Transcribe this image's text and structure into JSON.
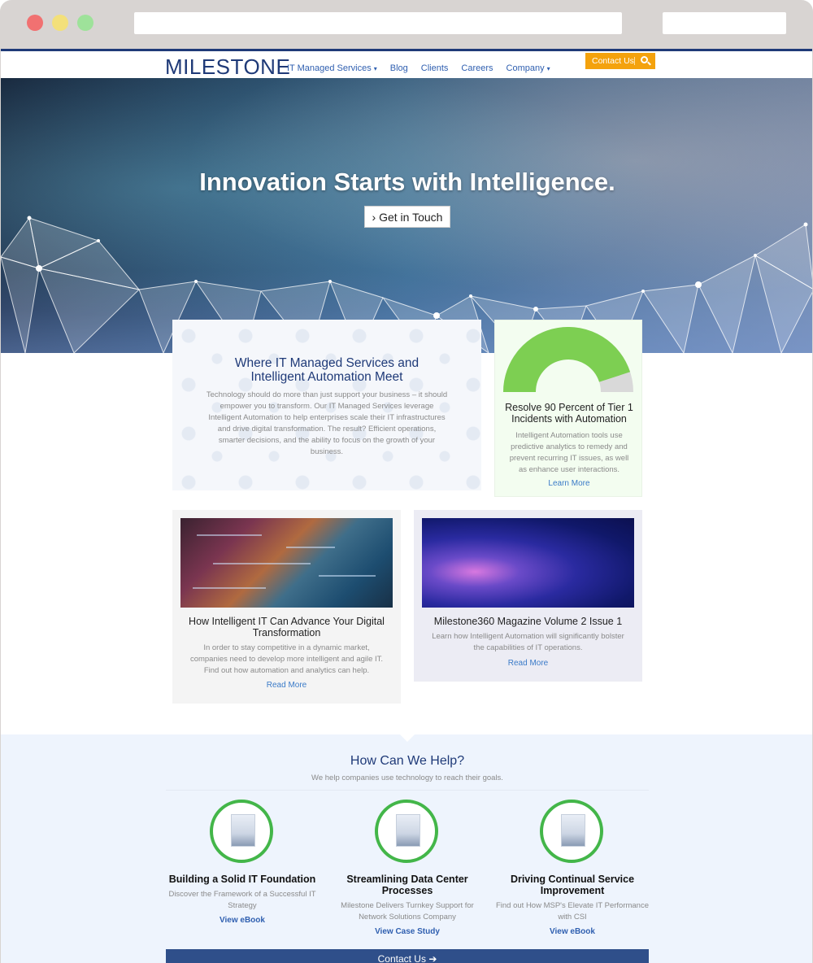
{
  "nav": {
    "logo_text": "MILESTONE",
    "links": [
      "IT Managed Services",
      "Blog",
      "Clients",
      "Careers",
      "Company"
    ],
    "contact_label": "Contact Us",
    "accent": "#f4a20d",
    "brand": "#1f3a78"
  },
  "hero": {
    "title": "Innovation Starts with Intelligence.",
    "button_label": "Get in Touch"
  },
  "intro": {
    "heading": "Where IT Managed Services and Intelligent Automation Meet",
    "body": "Technology should do more than just support your business – it should empower you to transform. Our IT Managed Services leverage Intelligent Automation to help enterprises scale their IT infrastructures and drive digital transformation. The result? Efficient operations, smarter decisions, and the ability to focus on the growth of your business."
  },
  "gauge_card": {
    "percent": 90,
    "title": "Resolve 90 Percent of Tier 1 Incidents with Automation",
    "body": "Intelligent Automation tools use predictive analytics to remedy and prevent recurring IT issues, as well as enhance user interactions.",
    "link": "Learn More",
    "fill_color": "#7dcf52",
    "rest_color": "#d9d9d9"
  },
  "articles": [
    {
      "title": "How Intelligent IT Can Advance Your Digital Transformation",
      "body": "In order to stay competitive in a dynamic market, companies need to develop more intelligent and agile IT. Find out how automation and analytics can help.",
      "link": "Read More"
    },
    {
      "title": "Milestone360 Magazine Volume 2 Issue 1",
      "body": "Learn how Intelligent Automation will significantly bolster the capabilities of IT operations.",
      "link": "Read More"
    }
  ],
  "help": {
    "heading": "How Can We Help?",
    "subheading": "We help companies use technology to reach their goals.",
    "items": [
      {
        "title": "Building a Solid IT Foundation",
        "body": "Discover the Framework of a Successful IT Strategy",
        "link": "View eBook"
      },
      {
        "title": "Streamlining Data Center Processes",
        "body": "Milestone Delivers Turnkey Support for Network Solutions Company",
        "link": "View Case Study"
      },
      {
        "title": "Driving Continual Service Improvement",
        "body": "Find out How MSP's Elevate IT Performance with CSI",
        "link": "View eBook"
      }
    ],
    "contact_label": "Contact Us"
  }
}
